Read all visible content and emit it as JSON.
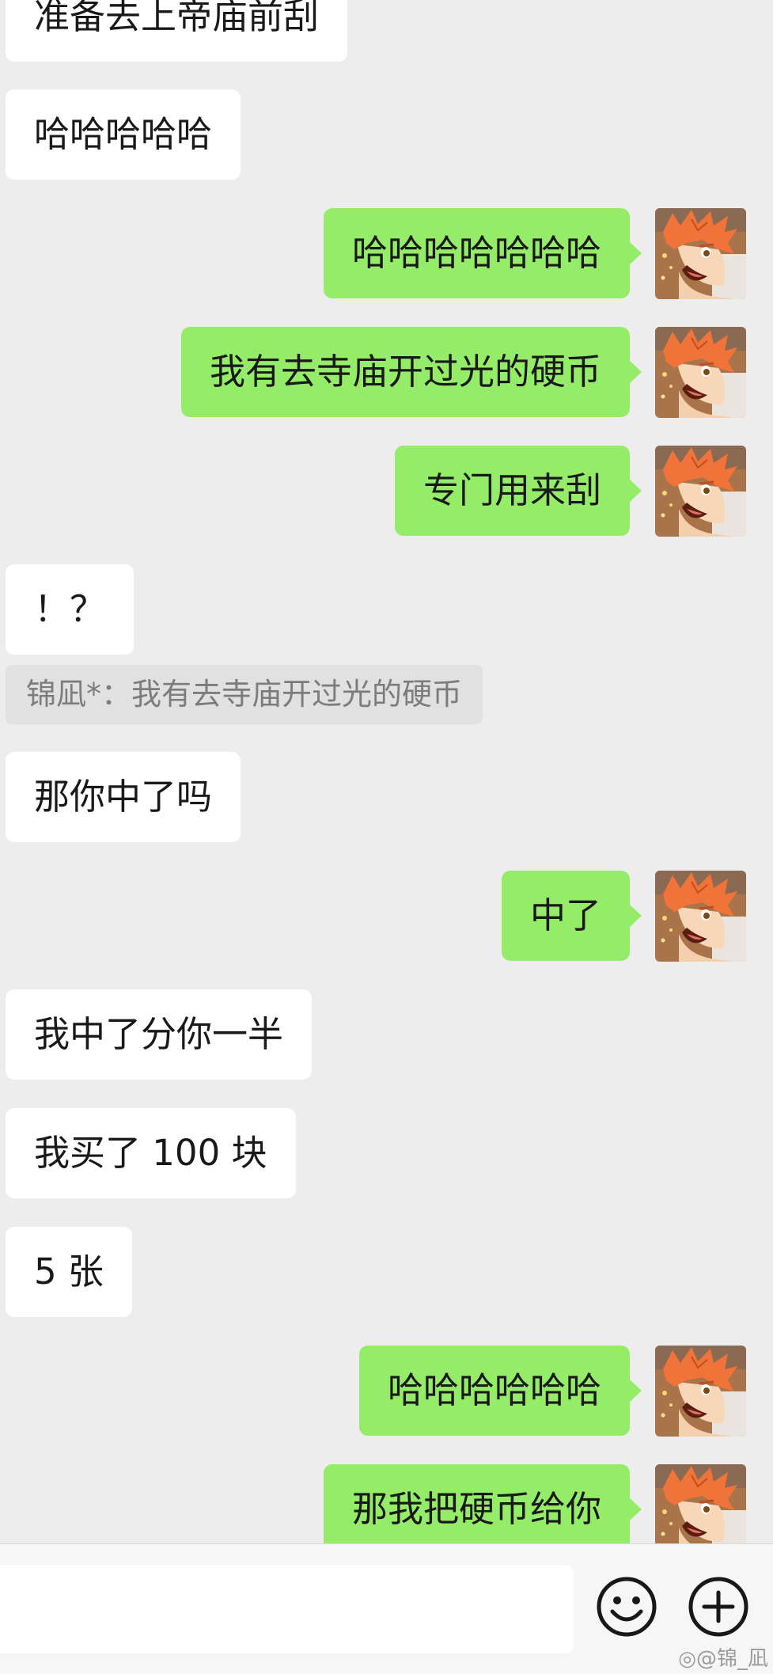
{
  "messages": [
    {
      "side": "left",
      "text": "准备去上帝庙前刮"
    },
    {
      "side": "left",
      "text": "哈哈哈哈哈"
    },
    {
      "side": "right",
      "text": "哈哈哈哈哈哈哈"
    },
    {
      "side": "right",
      "text": "我有去寺庙开过光的硬币"
    },
    {
      "side": "right",
      "text": "专门用来刮"
    },
    {
      "side": "left",
      "text": "！？"
    },
    {
      "side": "quote",
      "text": "锦凪*：我有去寺庙开过光的硬币"
    },
    {
      "side": "left",
      "text": "那你中了吗"
    },
    {
      "side": "right",
      "text": "中了"
    },
    {
      "side": "left",
      "text": "我中了分你一半"
    },
    {
      "side": "left",
      "text": "我买了 100 块"
    },
    {
      "side": "left",
      "text": "5 张"
    },
    {
      "side": "right",
      "text": "哈哈哈哈哈哈"
    },
    {
      "side": "right",
      "text": "那我把硬币给你"
    }
  ],
  "input_bar": {
    "placeholder": "",
    "emoji_icon": "smiley-face-icon",
    "more_icon": "plus-circle-icon"
  },
  "watermark": "@锦_凪",
  "colors": {
    "background": "#ededed",
    "sent_bubble": "#95ec69",
    "received_bubble": "#ffffff",
    "quote_bg": "#e1e1e1"
  }
}
